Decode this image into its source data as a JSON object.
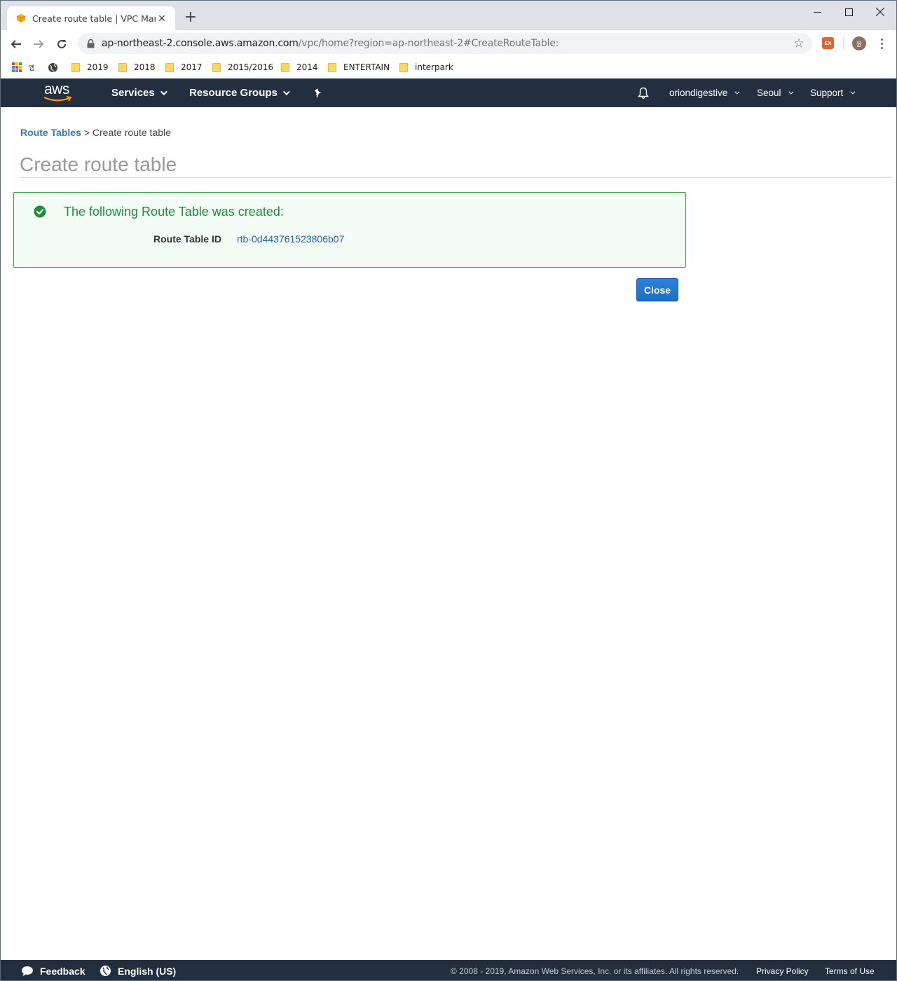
{
  "browser": {
    "tab_title": "Create route table | VPC Manag",
    "url_host": "ap-northeast-2.console.aws.amazon.com",
    "url_path": "/vpc/home?region=ap-northeast-2#CreateRouteTable:",
    "extension_label": "EX",
    "profile_initial": "윤",
    "apps_label": "앱",
    "bookmarks": [
      "2019",
      "2018",
      "2017",
      "2015/2016",
      "2014",
      "ENTERTAIN",
      "interpark"
    ]
  },
  "aws_nav": {
    "logo": "aws",
    "services": "Services",
    "resource_groups": "Resource Groups",
    "account": "oriondigestive",
    "region": "Seoul",
    "support": "Support"
  },
  "breadcrumb": {
    "parent": "Route Tables",
    "separator": ">",
    "current": "Create route table"
  },
  "page": {
    "title": "Create route table"
  },
  "alert": {
    "heading": "The following Route Table was created:",
    "label": "Route Table ID",
    "value": "rtb-0d443761523806b07"
  },
  "actions": {
    "close": "Close"
  },
  "footer": {
    "feedback": "Feedback",
    "language": "English (US)",
    "copyright": "© 2008 - 2019, Amazon Web Services, Inc. or its affiliates. All rights reserved.",
    "privacy": "Privacy Policy",
    "terms": "Terms of Use"
  },
  "colors": {
    "aws_nav_bg": "#232f3e",
    "success_green": "#1e8e3e",
    "link_blue": "#337ab7",
    "button_blue": "#1e6ec3"
  }
}
